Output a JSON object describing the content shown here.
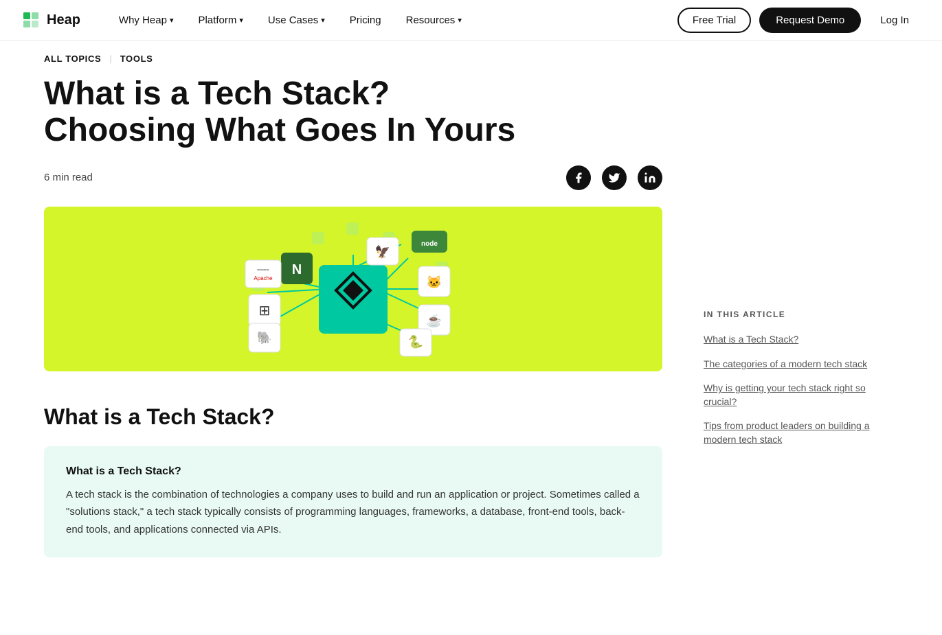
{
  "nav": {
    "logo_text": "Heap",
    "links": [
      {
        "label": "Why Heap",
        "has_dropdown": true
      },
      {
        "label": "Platform",
        "has_dropdown": true
      },
      {
        "label": "Use Cases",
        "has_dropdown": true
      },
      {
        "label": "Pricing",
        "has_dropdown": false
      },
      {
        "label": "Resources",
        "has_dropdown": true
      }
    ],
    "free_trial_label": "Free Trial",
    "request_demo_label": "Request Demo",
    "login_label": "Log In"
  },
  "breadcrumb": {
    "all_topics_label": "ALL TOPICS",
    "current_label": "TOOLS"
  },
  "article": {
    "title": "What is a Tech Stack? Choosing What Goes In Yours",
    "read_time": "6 min read",
    "social": {
      "facebook_label": "f",
      "twitter_label": "𝕏",
      "linkedin_label": "in"
    }
  },
  "section": {
    "heading": "What is a Tech Stack?",
    "info_box": {
      "title": "What is a Tech Stack?",
      "text": "A tech stack is the combination of technologies a company uses to build and run an application or project. Sometimes called a \"solutions stack,\" a tech stack typically consists of programming languages, frameworks, a database, front-end tools, back-end tools, and applications connected via APIs."
    }
  },
  "sidebar": {
    "toc_heading": "IN THIS ARTICLE",
    "links": [
      {
        "label": "What is a Tech Stack?"
      },
      {
        "label": "The categories of a modern tech stack"
      },
      {
        "label": "Why is getting your tech stack right so crucial?"
      },
      {
        "label": "Tips from product leaders on building a modern tech stack"
      }
    ]
  },
  "diagram": {
    "nodes": [
      {
        "label": "N",
        "color": "#2d7a3a",
        "style": "top:10px;left:210px;"
      },
      {
        "label": "≈",
        "color": "#fff",
        "style": "top:60px;left:100px;font-size:10px;"
      },
      {
        "label": "≋",
        "color": "#fff",
        "style": "top:110px;left:80px;"
      },
      {
        "label": "🐘",
        "color": "#fff",
        "style": "top:155px;left:90px;"
      },
      {
        "label": "🐦",
        "color": "#fff",
        "style": "top:20px;left:300px;"
      },
      {
        "label": "node",
        "color": "#3b8a50",
        "style": "top:25px;left:370px;font-size:9px;"
      },
      {
        "label": "🐱",
        "color": "#fff",
        "style": "top:80px;left:390px;"
      },
      {
        "label": "☕",
        "color": "#fff",
        "style": "top:130px;left:390px;"
      },
      {
        "label": "🐍",
        "color": "#fff",
        "style": "top:165px;left:360px;"
      }
    ]
  }
}
